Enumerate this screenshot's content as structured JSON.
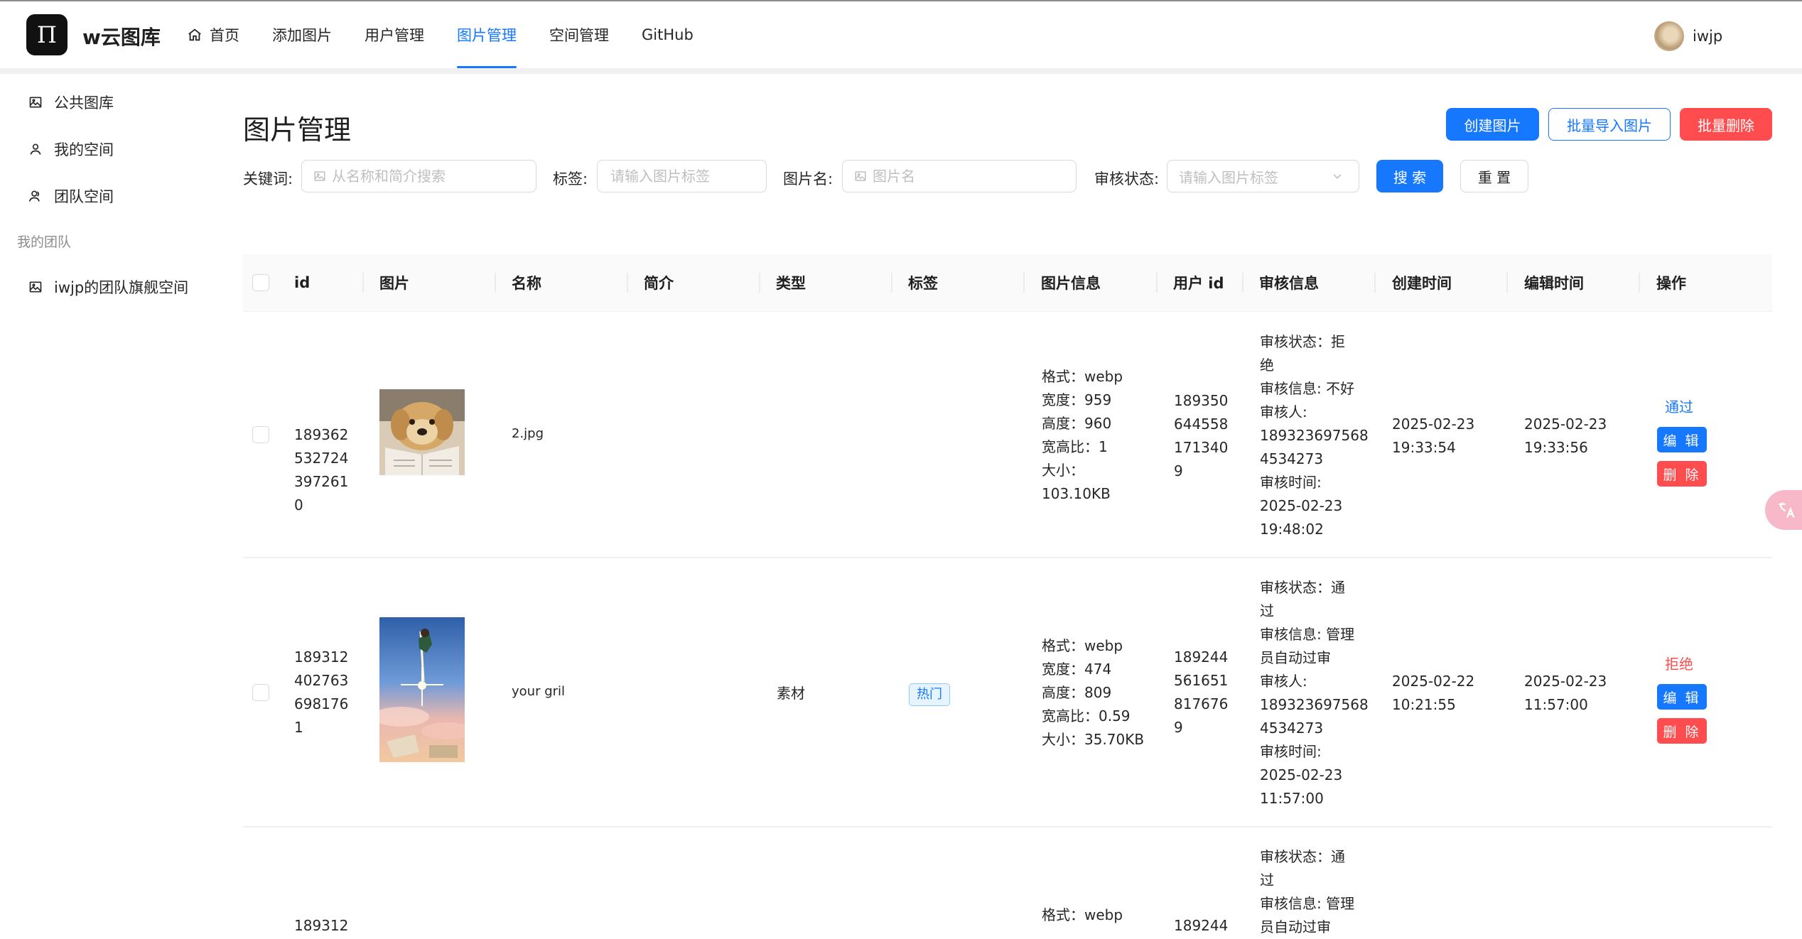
{
  "app": {
    "logo_glyph": "Π",
    "title": "w云图库"
  },
  "nav": [
    {
      "label": "首页",
      "icon": "home-icon"
    },
    {
      "label": "添加图片"
    },
    {
      "label": "用户管理"
    },
    {
      "label": "图片管理",
      "active": true
    },
    {
      "label": "空间管理"
    },
    {
      "label": "GitHub"
    }
  ],
  "user": {
    "name": "iwjp"
  },
  "sidebar": {
    "items": [
      {
        "label": "公共图库",
        "icon": "picture-icon"
      },
      {
        "label": "我的空间",
        "icon": "user-icon"
      },
      {
        "label": "团队空间",
        "icon": "team-icon"
      }
    ],
    "group_title": "我的团队",
    "team_items": [
      {
        "label": "iwjp的团队旗舰空间",
        "icon": "picture-icon"
      }
    ]
  },
  "page": {
    "title": "图片管理",
    "create_button": "创建图片",
    "batch_import_button": "批量导入图片",
    "batch_delete_button": "批量删除"
  },
  "filters": {
    "keyword_label": "关键词:",
    "keyword_placeholder": "从名称和简介搜索",
    "tag_label": "标签:",
    "tag_placeholder": "请输入图片标签",
    "name_label": "图片名:",
    "name_placeholder": "图片名",
    "review_label": "审核状态:",
    "review_placeholder": "请输入图片标签",
    "search_button": "搜 索",
    "reset_button": "重 置"
  },
  "table": {
    "columns": [
      "id",
      "图片",
      "名称",
      "简介",
      "类型",
      "标签",
      "图片信息",
      "用户 id",
      "审核信息",
      "创建时间",
      "编辑时间",
      "操作"
    ],
    "rows": [
      {
        "id_lines": [
          "189362",
          "532724",
          "397261",
          "0"
        ],
        "name": "2.jpg",
        "intro": "",
        "category": "",
        "tags": [],
        "info_lines": [
          "格式：webp",
          "宽度：959",
          "高度：960",
          "宽高比：1",
          "大小：",
          "103.10KB"
        ],
        "user_id_lines": [
          "189350",
          "644558",
          "171340",
          "9"
        ],
        "review_lines": [
          "审核状态：拒",
          "绝",
          "审核信息: 不好",
          "审核人:",
          "189323697568",
          "4534273",
          "审核时间:",
          "2025-02-23",
          "19:48:02"
        ],
        "create_lines": [
          "2025-02-23",
          "19:33:54"
        ],
        "edit_lines": [
          "2025-02-23",
          "19:33:56"
        ],
        "action_link": "通过",
        "action_link_color": "#1677ff",
        "edit_button": "编 辑",
        "delete_button": "删 除"
      },
      {
        "id_lines": [
          "189312",
          "402763",
          "698176",
          "1"
        ],
        "name": "your gril",
        "intro": "",
        "category": "素材",
        "tags": [
          "热门"
        ],
        "info_lines": [
          "格式：webp",
          "宽度：474",
          "高度：809",
          "宽高比：0.59",
          "大小：35.70KB"
        ],
        "user_id_lines": [
          "189244",
          "561651",
          "817676",
          "9"
        ],
        "review_lines": [
          "审核状态：通",
          "过",
          "审核信息: 管理",
          "员自动过审",
          "审核人:",
          "189323697568",
          "4534273",
          "审核时间:",
          "2025-02-23",
          "11:57:00"
        ],
        "create_lines": [
          "2025-02-22",
          "10:21:55"
        ],
        "edit_lines": [
          "2025-02-23",
          "11:57:00"
        ],
        "action_link": "拒绝",
        "action_link_color": "#ff4d4f",
        "edit_button": "编 辑",
        "delete_button": "删 除"
      },
      {
        "id_lines": [
          "189312"
        ],
        "info_lines": [
          "格式：webp"
        ],
        "user_id_lines": [
          "189244"
        ],
        "review_lines": [
          "审核状态：通",
          "过",
          "审核信息: 管理",
          "员自动过审"
        ]
      }
    ]
  },
  "colors": {
    "primary": "#1677ff",
    "danger": "#ff4d4f",
    "tag_bg": "#e6f4ff"
  }
}
